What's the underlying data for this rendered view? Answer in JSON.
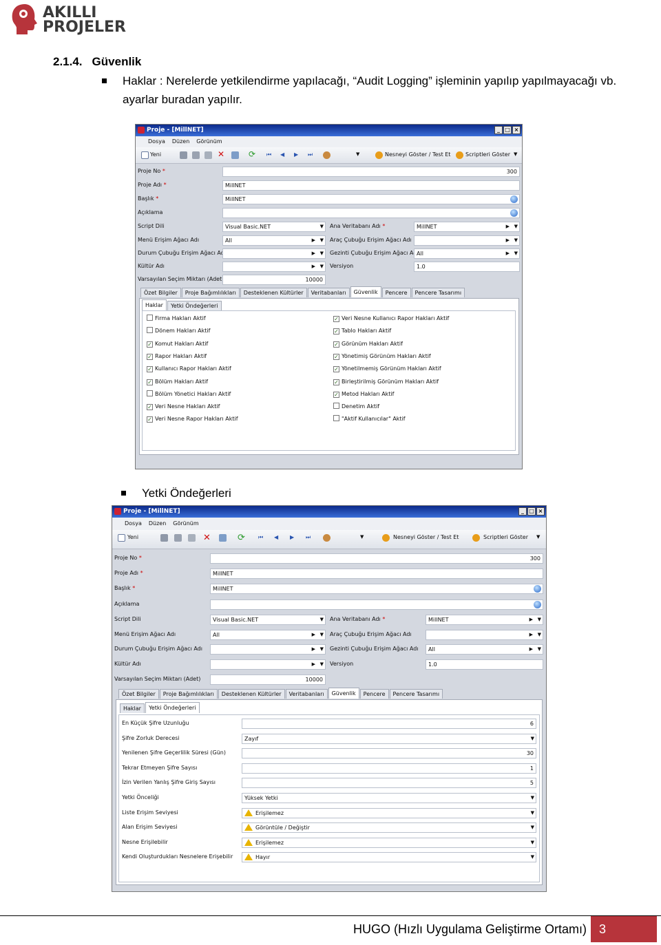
{
  "logo": {
    "line1": "AKILLI",
    "line2": "PROJELER"
  },
  "section": {
    "number": "2.1.4.",
    "title": "Güvenlik"
  },
  "bullet1": {
    "line1": "Haklar : Nerelerde yetkilendirme yapılacağı, “Audit Logging” işleminin yapılıp yapılmayacağı vb.",
    "line2": "ayarlar buradan yapılır."
  },
  "bullet2": "Yetki Öndeğerleri",
  "window": {
    "title": "Proje - [MillNET]",
    "menu": [
      "Dosya",
      "Düzen",
      "Görünüm"
    ],
    "toolbar": {
      "new": "Yeni",
      "show_object": "Nesneyi Göster / Test Et",
      "show_scripts": "Scriptleri Göster"
    },
    "fields": {
      "project_no": {
        "label": "Proje No",
        "value": "300"
      },
      "project_name": {
        "label": "Proje Adı",
        "value": "MillNET"
      },
      "heading": {
        "label": "Başlık",
        "value": "MillNET"
      },
      "description": {
        "label": "Açıklama",
        "value": ""
      },
      "script_lang": {
        "label": "Script Dili",
        "value": "Visual Basic.NET"
      },
      "main_db": {
        "label": "Ana Veritabanı Adı",
        "value": "MillNET"
      },
      "menu_tree": {
        "label": "Menü Erişim Ağacı Adı",
        "value": "All"
      },
      "toolbar_tree": {
        "label": "Araç Çubuğu Erişim Ağacı Adı",
        "value": ""
      },
      "status_tree": {
        "label": "Durum Çubuğu Erişim Ağacı Adı",
        "value": ""
      },
      "nav_tree": {
        "label": "Gezinti Çubuğu Erişim Ağacı Adı",
        "value": "All"
      },
      "culture": {
        "label": "Kültür Adı",
        "value": ""
      },
      "version": {
        "label": "Versiyon",
        "value": "1.0"
      },
      "default_select": {
        "label": "Varsayılan Seçim Miktarı (Adet)",
        "value": "10000"
      }
    },
    "req": "*",
    "tabs": [
      "Özet Bilgiler",
      "Proje Bağımlılıkları",
      "Desteklenen Kültürler",
      "Veritabanları",
      "Güvenlik",
      "Pencere",
      "Pencere Tasarımı"
    ],
    "subtabs": [
      "Haklar",
      "Yetki Öndeğerleri"
    ]
  },
  "rights_left": [
    {
      "label": "Firma Hakları Aktif",
      "checked": false
    },
    {
      "label": "Dönem Hakları Aktif",
      "checked": false
    },
    {
      "label": "Komut Hakları Aktif",
      "checked": true
    },
    {
      "label": "Rapor Hakları Aktif",
      "checked": true
    },
    {
      "label": "Kullanıcı Rapor Hakları Aktif",
      "checked": true
    },
    {
      "label": "Bölüm Hakları Aktif",
      "checked": true
    },
    {
      "label": "Bölüm Yönetici Hakları Aktif",
      "checked": false
    },
    {
      "label": "Veri Nesne Hakları Aktif",
      "checked": true
    },
    {
      "label": "Veri Nesne Rapor Hakları Aktif",
      "checked": true
    }
  ],
  "rights_right": [
    {
      "label": "Veri Nesne Kullanıcı Rapor Hakları Aktif",
      "checked": true
    },
    {
      "label": "Tablo Hakları Aktif",
      "checked": true
    },
    {
      "label": "Görünüm Hakları Aktif",
      "checked": true
    },
    {
      "label": "Yönetimiş Görünüm Hakları Aktif",
      "checked": true
    },
    {
      "label": "Yönetilmemiş Görünüm Hakları Aktif",
      "checked": true
    },
    {
      "label": "Birleştirilmiş Görünüm Hakları Aktif",
      "checked": true
    },
    {
      "label": "Metod Hakları Aktif",
      "checked": true
    },
    {
      "label": "Denetim Aktif",
      "checked": false
    },
    {
      "label": "\"Aktif Kullanıcılar\" Aktif",
      "checked": false
    }
  ],
  "defaults": [
    {
      "label": "En Küçük Şifre Uzunluğu",
      "value": "6",
      "kind": "num"
    },
    {
      "label": "Şifre Zorluk Derecesi",
      "value": "Zayıf",
      "kind": "dd"
    },
    {
      "label": "Yenilenen Şifre Geçerlilik Süresi (Gün)",
      "value": "30",
      "kind": "num"
    },
    {
      "label": "Tekrar Etmeyen Şifre Sayısı",
      "value": "1",
      "kind": "num"
    },
    {
      "label": "İzin Verilen Yanlış Şifre Giriş Sayısı",
      "value": "5",
      "kind": "num"
    },
    {
      "label": "Yetki Önceliği",
      "value": "Yüksek Yetki",
      "kind": "dd"
    },
    {
      "label": "Liste Erişim Seviyesi",
      "value": "Erişilemez",
      "kind": "warn"
    },
    {
      "label": "Alan Erişim Seviyesi",
      "value": "Görüntüle / Değiştir",
      "kind": "warn"
    },
    {
      "label": "Nesne Erişilebilir",
      "value": "Erişilemez",
      "kind": "warn"
    },
    {
      "label": "Kendi Oluşturdukları Nesnelere Erişebilir",
      "value": "Hayır",
      "kind": "warn"
    }
  ],
  "footer": {
    "text": "HUGO (Hızlı Uygulama Geliştirme Ortamı)",
    "page": "3"
  }
}
